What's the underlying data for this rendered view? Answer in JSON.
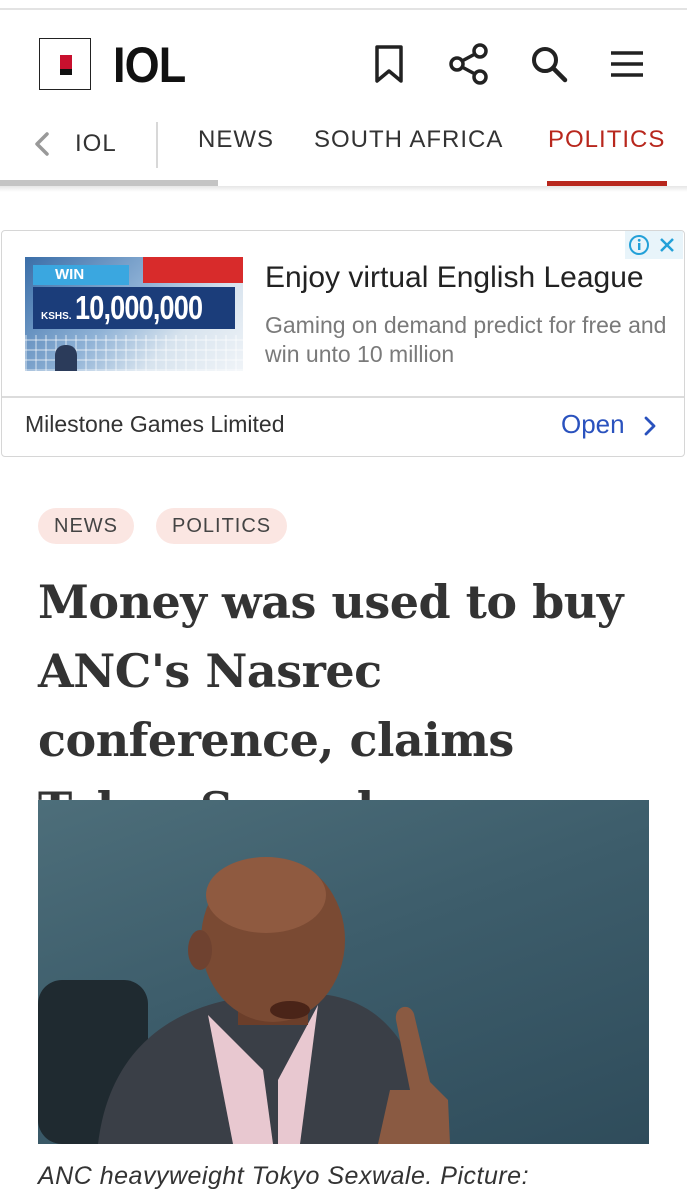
{
  "header": {
    "logo_text": "IOL",
    "icons": [
      "bookmark-icon",
      "share-icon",
      "search-icon",
      "menu-icon"
    ]
  },
  "nav": {
    "home_label": "IOL",
    "tabs": [
      {
        "label": "NEWS",
        "active": false
      },
      {
        "label": "SOUTH AFRICA",
        "active": false
      },
      {
        "label": "POLITICS",
        "active": true
      }
    ],
    "accent_color": "#b8271d"
  },
  "ad": {
    "image": {
      "win_label": "WIN",
      "currency": "KSHS.",
      "amount": "10,000,000"
    },
    "title": "Enjoy virtual English League",
    "description": "Gaming on demand predict for free and win unto 10 million",
    "advertiser": "Milestone Games Limited",
    "cta_label": "Open",
    "cta_color": "#2a52be"
  },
  "article": {
    "tags": [
      "NEWS",
      "POLITICS"
    ],
    "headline": "Money was used to buy ANC's Nasrec conference, claims Tokyo Sexwale",
    "caption": "ANC heavyweight Tokyo Sexwale. Picture:"
  }
}
